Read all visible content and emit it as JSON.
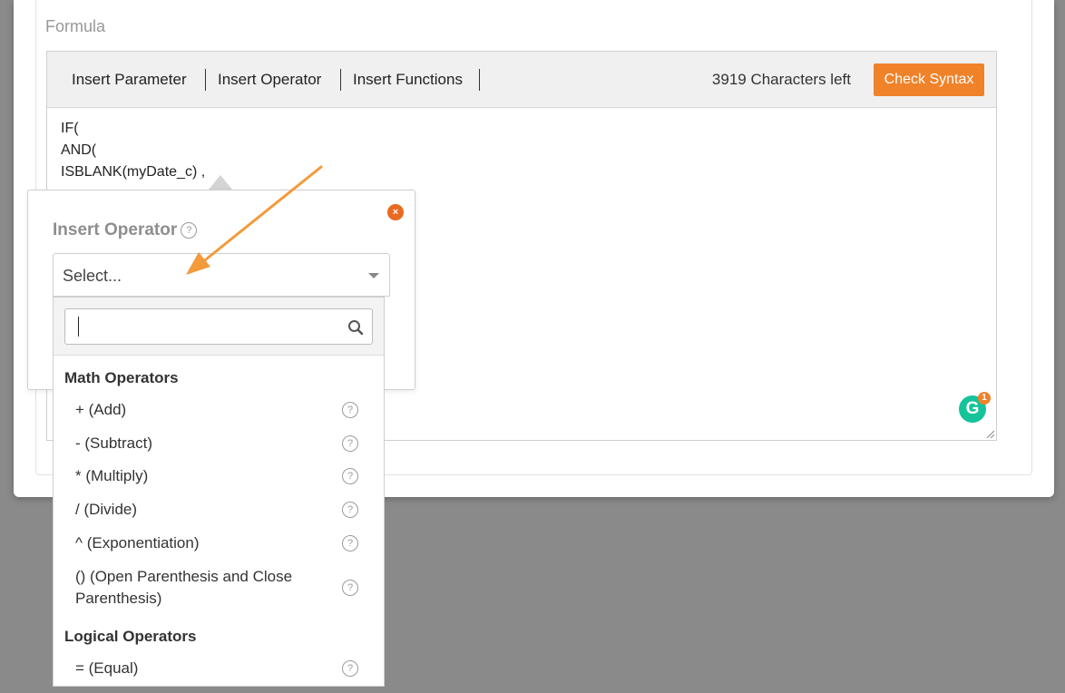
{
  "formula": {
    "label": "Formula",
    "toolbar": {
      "insert_parameter": "Insert Parameter",
      "insert_operator": "Insert Operator",
      "insert_functions": "Insert Functions",
      "characters_left": "3919 Characters left",
      "check_syntax": "Check Syntax"
    },
    "code_lines": [
      "IF(",
      "AND(",
      "ISBLANK(myDate_c) ,"
    ]
  },
  "popover": {
    "title": "Insert Operator",
    "help_glyph": "?",
    "close_glyph": "×",
    "select": {
      "value": "Select..."
    },
    "search": {
      "value": ""
    },
    "groups": [
      {
        "label": "Math Operators",
        "options": [
          {
            "label": "+ (Add)"
          },
          {
            "label": "- (Subtract)"
          },
          {
            "label": "* (Multiply)"
          },
          {
            "label": "/ (Divide)"
          },
          {
            "label": "^ (Exponentiation)"
          },
          {
            "label": "() (Open Parenthesis and Close",
            "label_line2": "Parenthesis)"
          }
        ]
      },
      {
        "label": "Logical Operators",
        "options": [
          {
            "label": "= (Equal)"
          }
        ]
      }
    ]
  },
  "grammarly": {
    "letter": "G",
    "count": "1"
  },
  "colors": {
    "accent": "#f0822a",
    "close": "#ea6a22",
    "grammarly": "#15c39a",
    "overlay": "#8a8a8a"
  },
  "icons": [
    "search-icon",
    "close-icon",
    "help-icon",
    "chevron-down-icon",
    "grammarly-icon",
    "resize-handle-icon",
    "annotation-arrow"
  ]
}
